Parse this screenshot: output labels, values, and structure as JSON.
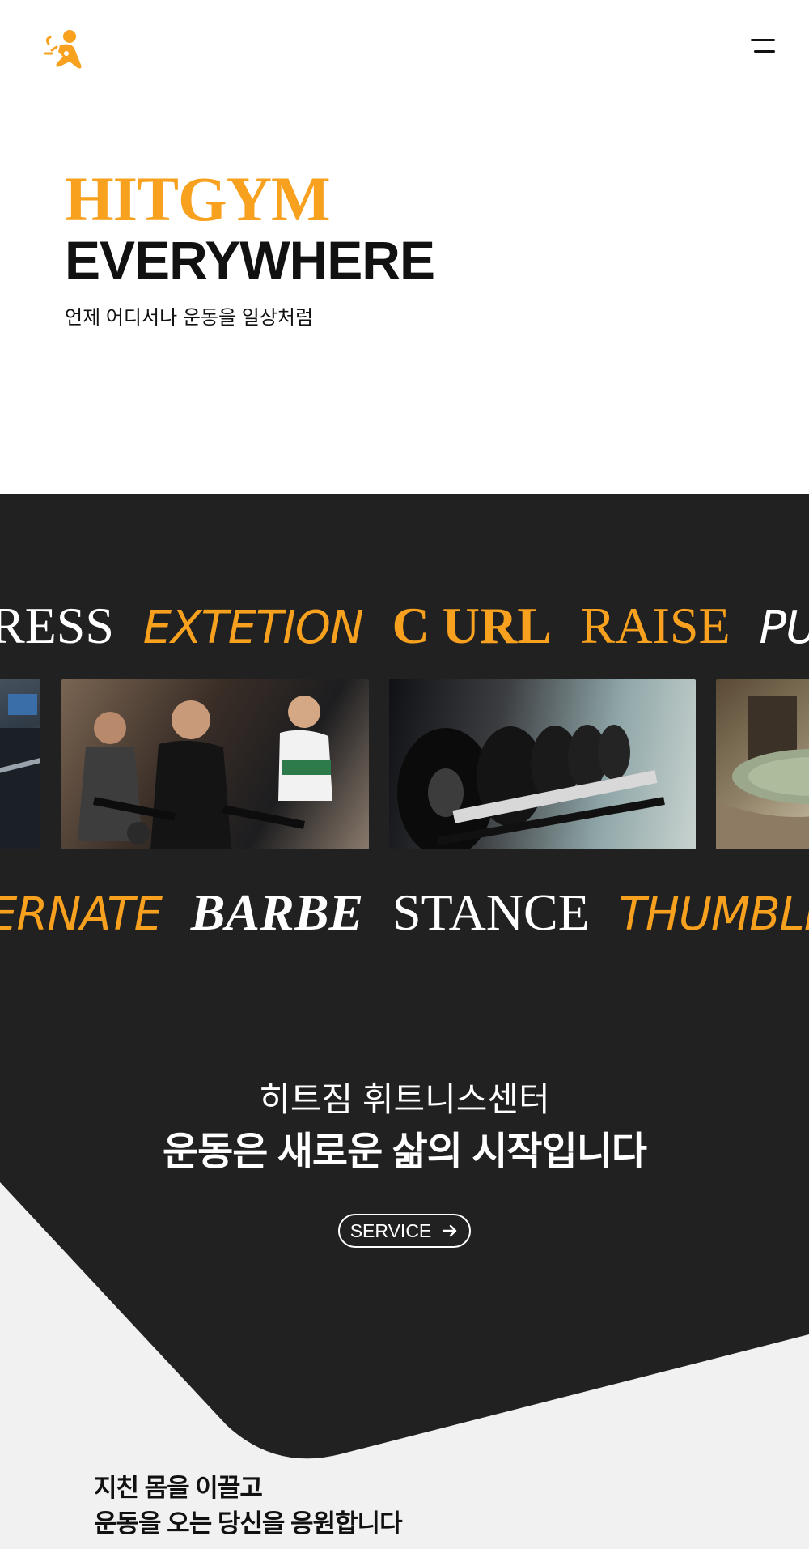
{
  "header": {
    "logo_icon": "running-person-logo-icon",
    "menu_icon": "hamburger-menu-icon"
  },
  "hero": {
    "title_line1": "HITGYM",
    "title_line2": "EVERYWHERE",
    "subtitle": "언제 어디서나 운동을 일상처럼"
  },
  "marquee_top": {
    "words": [
      "RESS",
      "EXTETION",
      "C URL",
      "RAISE",
      "PULL"
    ]
  },
  "gallery": {
    "photos": [
      "treadmill-photo",
      "spinning-class-photo",
      "dumbbell-rack-photo",
      "spa-pool-photo"
    ]
  },
  "marquee_bottom": {
    "words": [
      "ERNATE",
      "BARBE",
      "STANCE",
      "THUMBLE"
    ]
  },
  "intro": {
    "subtitle": "히트짐 휘트니스센터",
    "title": "운동은 새로운 삶의 시작입니다",
    "service_button": "SERVICE"
  },
  "bottom": {
    "line1": "지친 몸을 이끌고",
    "line2": "운동을 오는 당신을 응원합니다"
  },
  "colors": {
    "accent": "#f7a11f",
    "dark": "#212121",
    "light_bg": "#f1f1f1"
  }
}
